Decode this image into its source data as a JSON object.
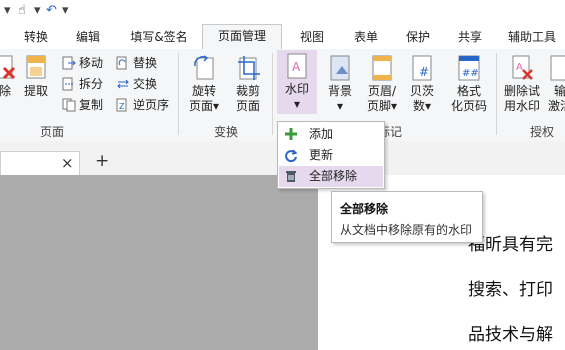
{
  "ribbon_tabs": [
    "转换",
    "编辑",
    "填写&签名",
    "页面管理",
    "视图",
    "表单",
    "保护",
    "共享",
    "辅助工具"
  ],
  "active_tab": "页面管理",
  "page_group": {
    "delete_partial": "除",
    "extract": "提取",
    "move": "移动",
    "split": "拆分",
    "copy": "复制",
    "replace": "替换",
    "swap": "交换",
    "reverse": "逆页序",
    "label": "页面"
  },
  "transform_group": {
    "rotate_line1": "旋转",
    "rotate_line2": "页面",
    "crop_line1": "裁剪",
    "crop_line2": "页面",
    "label": "变换"
  },
  "mark_group": {
    "watermark": "水印",
    "background": "背景",
    "header_line1": "页眉/",
    "header_line2": "页脚",
    "bates_line1": "贝茨",
    "bates_line2": "数",
    "format_line1": "格式",
    "format_line2": "化页码",
    "label_partial": "标记"
  },
  "protect_group": {
    "remove_wm_line1": "删除试",
    "remove_wm_line2": "用水印",
    "next_partial_line1": "输",
    "next_partial_line2": "激活",
    "label": "授权"
  },
  "watermark_menu": {
    "items": [
      "添加",
      "更新",
      "全部移除"
    ],
    "selected": "全部移除"
  },
  "tooltip": {
    "title": "全部移除",
    "description": "从文档中移除原有的水印"
  },
  "doc_tabs": {
    "close": "×",
    "add": "+"
  },
  "document_text": {
    "line1": "福昕具有完",
    "line2": "搜索、打印",
    "line3": "品技术与解"
  }
}
